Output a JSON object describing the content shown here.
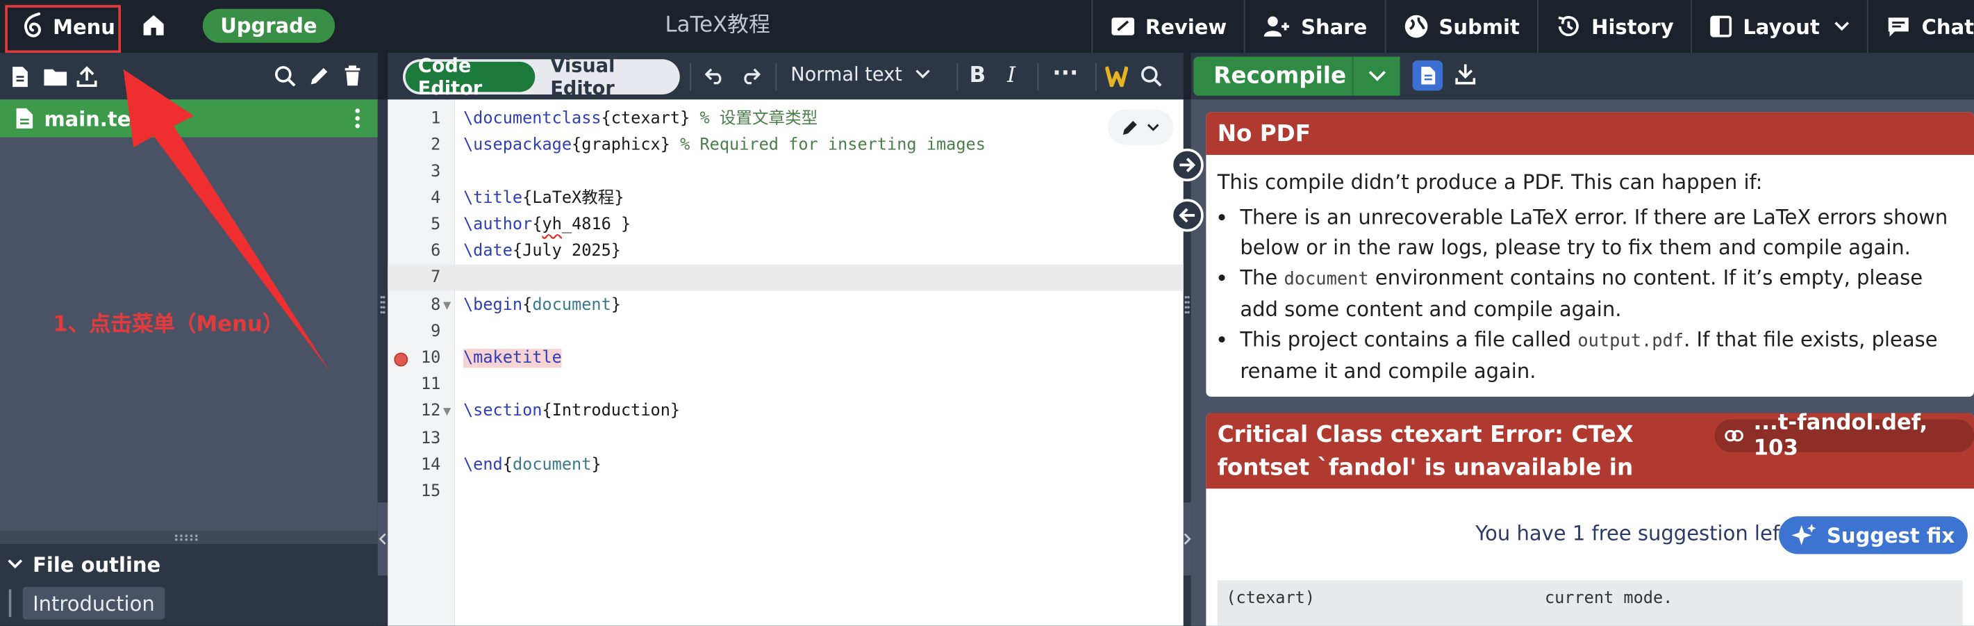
{
  "topbar": {
    "menu_label": "Menu",
    "upgrade_label": "Upgrade",
    "document_title": "LaTeX教程",
    "actions": {
      "review": "Review",
      "share": "Share",
      "submit": "Submit",
      "history": "History",
      "layout": "Layout",
      "chat": "Chat"
    }
  },
  "editor_toolbar": {
    "code_editor_label": "Code Editor",
    "visual_editor_label": "Visual Editor",
    "text_style": "Normal text",
    "bold_label": "B",
    "italic_label": "I",
    "more_label": "···"
  },
  "pdf_toolbar": {
    "recompile_label": "Recompile"
  },
  "file_tree": {
    "active_file": "main.tex"
  },
  "outline": {
    "title": "File outline",
    "items": [
      "Introduction"
    ]
  },
  "editor": {
    "lines": [
      {
        "num": "1",
        "cmd": "\\documentclass",
        "arg": "{ctexart}",
        "comment": " % 设置文章类型"
      },
      {
        "num": "2",
        "cmd": "\\usepackage",
        "arg": "{graphicx}",
        "comment": " % Required for inserting images"
      },
      {
        "num": "3"
      },
      {
        "num": "4",
        "cmd": "\\title",
        "arg": "{LaTeX教程}"
      },
      {
        "num": "5",
        "cmd": "\\author",
        "arg_open": "{",
        "arg_squiggle": "yh",
        "arg_rest": "_4816 }"
      },
      {
        "num": "6",
        "cmd": "\\date",
        "arg": "{July 2025}"
      },
      {
        "num": "7"
      },
      {
        "num": "8",
        "cmd": "\\begin",
        "arg_open": "{",
        "env": "document",
        "arg_close": "}"
      },
      {
        "num": "9"
      },
      {
        "num": "10",
        "cmd": "\\maketitle"
      },
      {
        "num": "11"
      },
      {
        "num": "12",
        "cmd": "\\section",
        "arg": "{Introduction}"
      },
      {
        "num": "13"
      },
      {
        "num": "14",
        "cmd": "\\end",
        "arg_open": "{",
        "env": "document",
        "arg_close": "}"
      },
      {
        "num": "15"
      }
    ]
  },
  "pdf": {
    "no_pdf_title": "No PDF",
    "no_pdf_intro": "This compile didn’t produce a PDF. This can happen if:",
    "reason1": "There is an unrecoverable LaTeX error. If there are LaTeX errors shown below or in the raw logs, please try to fix them and compile again.",
    "reason2_pre": "The ",
    "reason2_code": "document",
    "reason2_post": " environment contains no content. If it’s empty, please add some content and compile again.",
    "reason3_pre": "This project contains a file called ",
    "reason3_code": "output.pdf",
    "reason3_post": ". If that file exists, please rename it and compile again.",
    "error_title": "Critical Class ctexart Error: CTeX fontset `fandol' is unavailable in",
    "error_location": "...t-fandol.def, 103",
    "suggestion_text": "You have 1 free suggestion left",
    "suggest_fix_label": "Suggest fix",
    "raw_log_left": "(ctexart)",
    "raw_log_right": "current mode."
  },
  "annotation": {
    "text": "1、点击菜单（Menu）",
    "color": "#e23b3b"
  },
  "colors": {
    "topbar_bg": "#1b222c",
    "green_accent": "#3a8f46",
    "error_red": "#b03a30",
    "blue_accent": "#3e74d1"
  }
}
